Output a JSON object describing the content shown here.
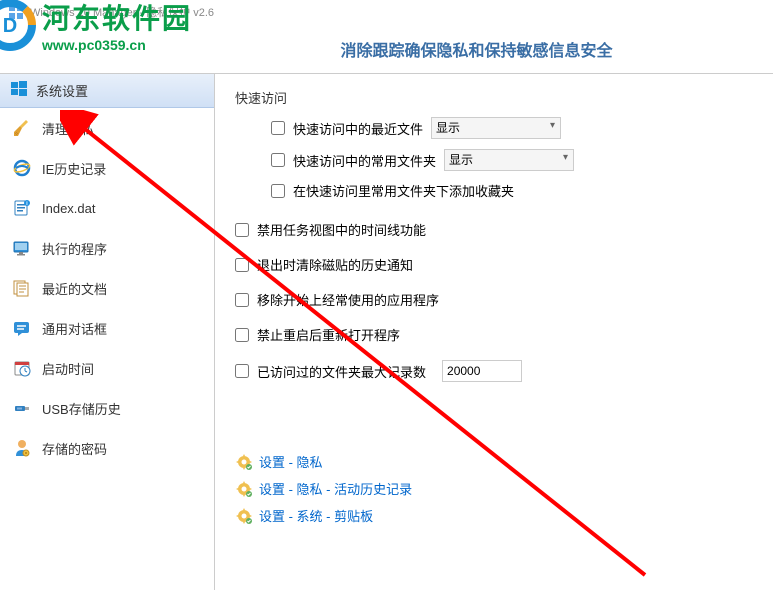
{
  "window": {
    "title": "Windows 10 Manager - 隐私保护 v2.6"
  },
  "watermark": {
    "main": "河东软件园",
    "sub": "www.pc0359.cn"
  },
  "header": {
    "title": "消除跟踪确保隐私和保持敏感信息安全"
  },
  "sidebar": {
    "header": "系统设置",
    "items": [
      {
        "label": "清理隐私",
        "icon": "broom"
      },
      {
        "label": "IE历史记录",
        "icon": "ie"
      },
      {
        "label": "Index.dat",
        "icon": "indexdat"
      },
      {
        "label": "执行的程序",
        "icon": "exec"
      },
      {
        "label": "最近的文档",
        "icon": "recentdoc"
      },
      {
        "label": "通用对话框",
        "icon": "dialog"
      },
      {
        "label": "启动时间",
        "icon": "starttime"
      },
      {
        "label": "USB存储历史",
        "icon": "usb"
      },
      {
        "label": "存储的密码",
        "icon": "password"
      }
    ]
  },
  "main": {
    "quickAccess": {
      "title": "快速访问",
      "opt1": {
        "label": "快速访问中的最近文件",
        "dropdown": "显示"
      },
      "opt2": {
        "label": "快速访问中的常用文件夹",
        "dropdown": "显示"
      },
      "opt3": {
        "label": "在快速访问里常用文件夹下添加收藏夹"
      }
    },
    "options": {
      "opt1": "禁用任务视图中的时间线功能",
      "opt2": "退出时清除磁贴的历史通知",
      "opt3": "移除开始上经常使用的应用程序",
      "opt4": "禁止重启后重新打开程序",
      "opt5": {
        "label": "已访问过的文件夹最大记录数",
        "value": "20000"
      }
    },
    "links": {
      "l1": "设置 - 隐私",
      "l2": "设置 - 隐私 - 活动历史记录",
      "l3": "设置 - 系统 - 剪贴板"
    }
  }
}
